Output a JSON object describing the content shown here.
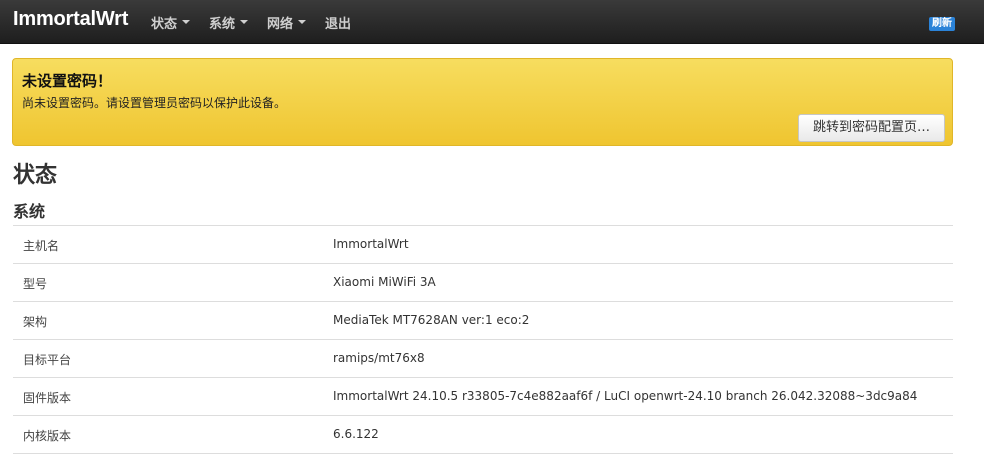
{
  "header": {
    "brand": "ImmortalWrt",
    "nav": [
      {
        "label": "状态",
        "dropdown": true
      },
      {
        "label": "系统",
        "dropdown": true
      },
      {
        "label": "网络",
        "dropdown": true
      },
      {
        "label": "退出",
        "dropdown": false
      }
    ],
    "refresh_badge": "刷新",
    "refresh_color": "#2b83d8"
  },
  "alert": {
    "title": "未设置密码！",
    "text": "尚未设置密码。请设置管理员密码以保护此设备。",
    "button_label": "跳转到密码配置页…",
    "color": "#f0c93a"
  },
  "page": {
    "title": "状态",
    "section_title": "系统"
  },
  "system_info": [
    {
      "label": "主机名",
      "value": "ImmortalWrt"
    },
    {
      "label": "型号",
      "value": "Xiaomi MiWiFi 3A"
    },
    {
      "label": "架构",
      "value": "MediaTek MT7628AN ver:1 eco:2"
    },
    {
      "label": "目标平台",
      "value": "ramips/mt76x8"
    },
    {
      "label": "固件版本",
      "value": "ImmortalWrt 24.10.5 r33805-7c4e882aaf6f / LuCI openwrt-24.10 branch 26.042.32088~3dc9a84"
    },
    {
      "label": "内核版本",
      "value": "6.6.122"
    }
  ]
}
